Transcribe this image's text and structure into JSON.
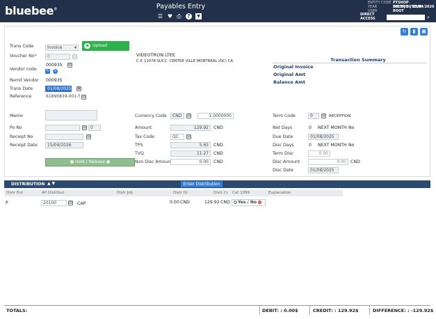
{
  "app": {
    "logo": "bluebee",
    "title": "Payables Entry"
  },
  "meta": {
    "entity_code_label": "ENTITY CODE",
    "entity_code": "PTSHOP DISTRIBUTEUR",
    "year_label": "YEAR",
    "year": "2013 | 3 | 15/04/2026",
    "user_label": "USER",
    "user": "ROOT",
    "direct_access_label": "DIRECT ACCESS"
  },
  "toolbar_icons": [
    "list-icon",
    "heart-icon",
    "print-icon",
    "help-icon",
    "download-icon"
  ],
  "form": {
    "trans_code_label": "Trans Code",
    "trans_code_value": "Invoice",
    "upload_label": "Upload document",
    "voucher_no_label": "Voucher No",
    "voucher_no_value": "0",
    "vendor_code_label": "Vendor code",
    "vendor_code_value": "000935",
    "remit_vendor_label": "Remit Vendor",
    "remit_vendor_value": "000935",
    "trans_date_label": "Trans Date",
    "trans_date_value": "01/08/2025",
    "reference_label": "Reference",
    "reference_value": "61890839-001-5",
    "vendor_name": "VIDEOTRON LTEE",
    "vendor_address": "C.P. 11078 SUCC. CENTRE VILLE   MONTREAL   (QC)   CA",
    "memo_label": "Memo",
    "po_no_label": "Po No",
    "po_no_value": "0",
    "receipt_no_label": "Receipt No",
    "receipt_date_label": "Receipt Date",
    "receipt_date_value": "15/04/2026",
    "hold_label": "Hold / Release",
    "currency_code_label": "Currency Code",
    "currency_code_value": "CND",
    "exchange_rate": "1.0000000",
    "amount_label": "Amount",
    "amount_value": "129.92",
    "amount_cur": "CND",
    "tax_code_label": "Tax Code",
    "tax_code_value": "QC",
    "tps_label": "TPS",
    "tps_value": "5.65",
    "tps_cur": "CND",
    "tvq_label": "TVQ",
    "tvq_value": "11.27",
    "tvq_cur": "CND",
    "non_disc_label": "Non Disc Amount",
    "non_disc_value": "0.00",
    "non_disc_cur": "CND",
    "term_code_label": "Term Code",
    "term_code_value": "0",
    "term_code_desc": "RECEPTION",
    "net_days_label": "Net Days",
    "net_days_value": "0",
    "net_days_desc": "NEXT MONTH",
    "net_days_no": "No",
    "due_date_label": "Due Date",
    "due_date_value": "01/08/2025",
    "disc_days_label": "Disc Days",
    "disc_days_value": "0",
    "disc_days_desc": "NEXT MONTH",
    "disc_days_no": "No",
    "term_disc_label": "Term Disc",
    "term_disc_value": "0.00",
    "disc_amount_label": "Disc Amount",
    "disc_amount_value": "0.00",
    "disc_amount_cur": "CND",
    "disc_date_label": "Disc Date",
    "disc_date_value": "01/08/2025"
  },
  "summary": {
    "title": "Transaction Summary",
    "original_invoice": "Original Invoice",
    "original_amt": "Original Amt",
    "balance_amt": "Balance Amt"
  },
  "distribution": {
    "title": "DISTRIBUTION",
    "enter_label": "Enter Distribution",
    "columns": [
      "Distr Ent",
      "AP Distribut",
      "Distr Job",
      "Distr Dr",
      "Distr Cr",
      "Cat 1099",
      "Explanation"
    ],
    "row": {
      "ent": "P",
      "account": "20100",
      "account_desc": "CAP",
      "dr": "0.00",
      "dr_cur": "CND",
      "cr": "129.92",
      "cr_cur": "CND",
      "yes": "Yes",
      "no": "No"
    }
  },
  "totals": {
    "label": "TOTALS:",
    "debit": "DEBIT: : 0.00$",
    "credit": "CREDIT: : 129.92$",
    "difference": "DIFFERENCE: : -129.92$"
  }
}
